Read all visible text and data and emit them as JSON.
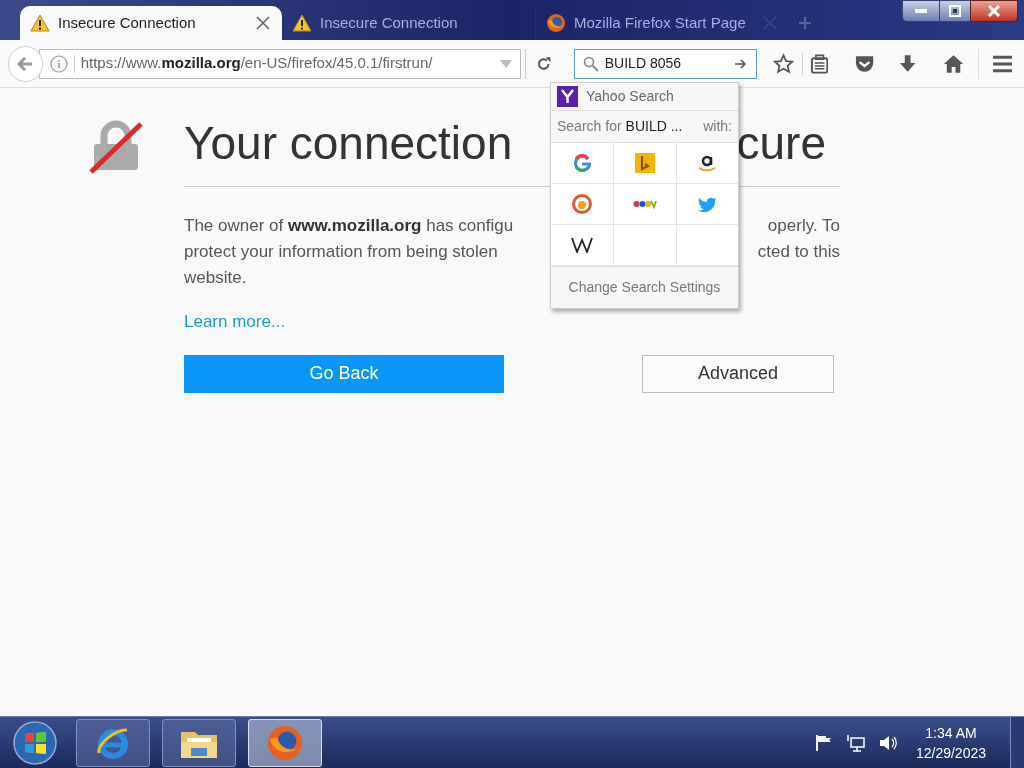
{
  "tabs": [
    {
      "title": "Insecure Connection",
      "kind": "warning",
      "selected": true
    },
    {
      "title": "Insecure Connection",
      "kind": "warning",
      "selected": false
    },
    {
      "title": "Mozilla Firefox Start Page",
      "kind": "firefox",
      "selected": false
    }
  ],
  "url": "https://www.**mozilla.org**/en-US/firefox/45.0.1/firstrun/",
  "search_field": {
    "value": "BUILD 8056"
  },
  "search_popup": {
    "current_engine": "Yahoo Search",
    "prompt_prefix": "Search for",
    "query": "BUILD ...",
    "prompt_suffix": "with:",
    "engines": [
      {
        "kind": "google"
      },
      {
        "kind": "bing"
      },
      {
        "kind": "amazon"
      },
      {
        "kind": "duckduckgo"
      },
      {
        "kind": "ebay"
      },
      {
        "kind": "twitter"
      },
      {
        "kind": "wikipedia"
      }
    ],
    "settings_button": "Change Search Settings"
  },
  "page": {
    "heading_parts": [
      "Your connection",
      "cure"
    ],
    "lines": [
      {
        "left": "The owner of **www.mozilla.org** has configu",
        "right": "operly. To"
      },
      {
        "left": "protect your information from being stolen",
        "right": "cted to this"
      },
      {
        "left": "website."
      }
    ],
    "learn_more": "Learn more...",
    "buttons": [
      {
        "label": "Go Back",
        "kind": "primary"
      },
      {
        "label": "Advanced",
        "kind": "secondary"
      }
    ]
  },
  "taskbar": {
    "apps": [
      {
        "kind": "ie",
        "active": false
      },
      {
        "kind": "folder",
        "active": false
      },
      {
        "kind": "firefox",
        "active": true
      }
    ],
    "clock": {
      "time": "1:34 AM",
      "date": "12/29/2023"
    }
  }
}
